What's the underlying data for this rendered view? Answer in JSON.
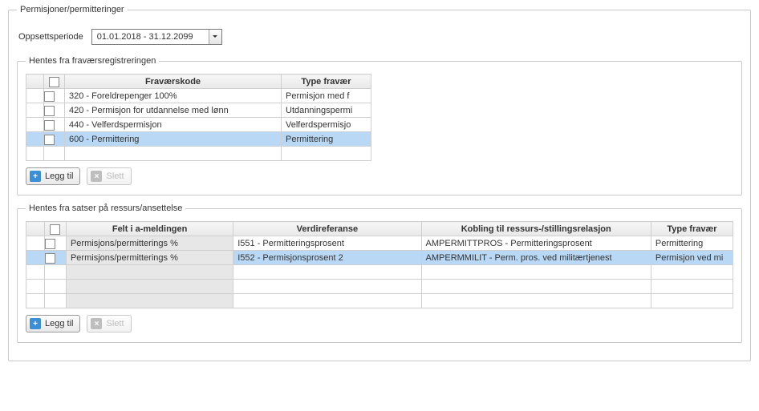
{
  "legend_main": "Permisjoner/permitteringer",
  "setup": {
    "label": "Oppsettsperiode",
    "value": "01.01.2018 - 31.12.2099"
  },
  "grid1": {
    "legend": "Hentes fra fraværsregistreringen",
    "headers": {
      "code": "Fraværskode",
      "type": "Type fravær"
    },
    "rows": [
      {
        "code": "320 - Foreldrepenger 100%",
        "type": "Permisjon med f",
        "selected": false
      },
      {
        "code": "420 - Permisjon for utdannelse med lønn",
        "type": "Utdanningspermi",
        "selected": false
      },
      {
        "code": "440 - Velferdspermisjon",
        "type": "Velferdspermisjo",
        "selected": false
      },
      {
        "code": "600 - Permittering",
        "type": "Permittering",
        "selected": true
      }
    ],
    "empty_rows": 1
  },
  "grid2": {
    "legend": "Hentes fra satser på ressurs/ansettelse",
    "headers": {
      "felt": "Felt i a-meldingen",
      "verdi": "Verdireferanse",
      "kobling": "Kobling til ressurs-/stillingsrelasjon",
      "type": "Type fravær"
    },
    "rows": [
      {
        "felt": "Permisjons/permitterings %",
        "verdi": "I551 - Permitteringsprosent",
        "kobling": "AMPERMITTPROS - Permitteringsprosent",
        "type": "Permittering",
        "selected": false
      },
      {
        "felt": "Permisjons/permitterings %",
        "verdi": "I552 - Permisjonsprosent 2",
        "kobling": "AMPERMMILIT - Perm. pros. ved militærtjenest",
        "type": "Permisjon ved mi",
        "selected": true
      }
    ],
    "empty_rows": 3
  },
  "buttons": {
    "add": "Legg til",
    "delete": "Slett"
  }
}
